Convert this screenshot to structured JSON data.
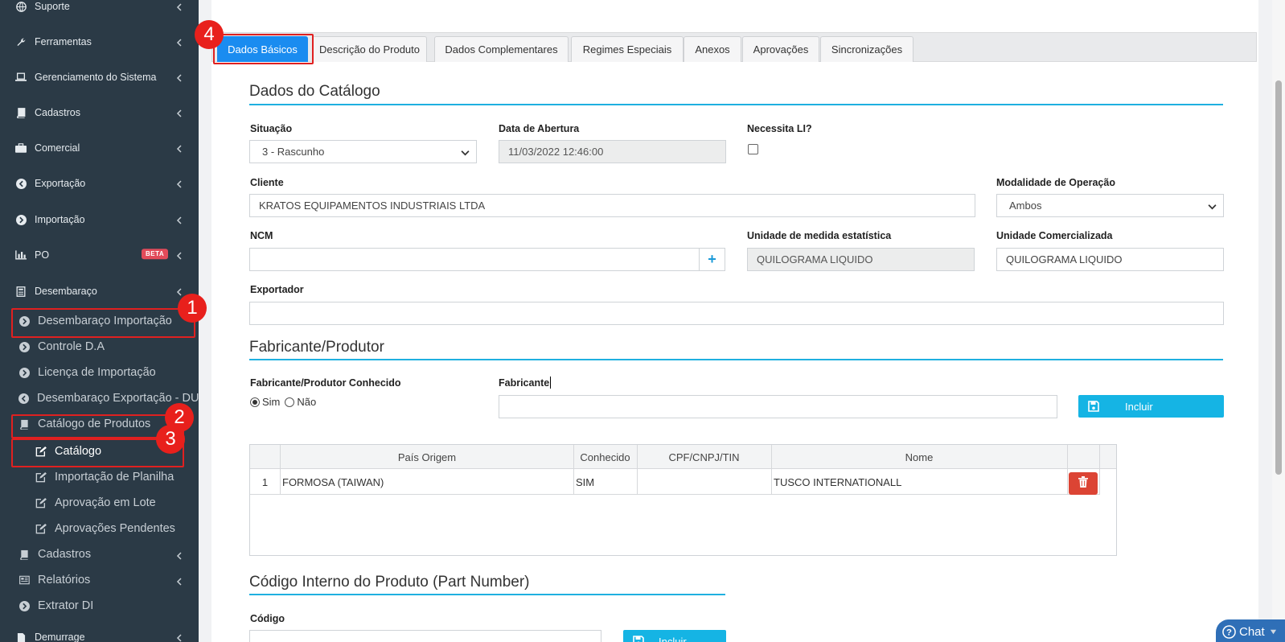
{
  "sidebar": {
    "items": [
      {
        "label": "Suporte",
        "icon": "globe-icon"
      },
      {
        "label": "Ferramentas",
        "icon": "wrench-icon"
      },
      {
        "label": "Gerenciamento do Sistema",
        "icon": "laptop-icon"
      },
      {
        "label": "Cadastros",
        "icon": "book-icon"
      },
      {
        "label": "Comercial",
        "icon": "briefcase-icon"
      },
      {
        "label": "Exportação",
        "icon": "arrow-circle-left-icon"
      },
      {
        "label": "Importação",
        "icon": "arrow-circle-right-icon"
      },
      {
        "label": "PO",
        "icon": "bar-chart-icon",
        "badge": "BETA"
      },
      {
        "label": "Desembaraço",
        "icon": "calculator-icon"
      }
    ],
    "subitems": [
      {
        "label": "Desembaraço Importação",
        "icon": "arrow-circle-right-icon"
      },
      {
        "label": "Controle D.A",
        "icon": "arrow-circle-right-icon"
      },
      {
        "label": "Licença de Importação",
        "icon": "arrow-circle-right-icon"
      },
      {
        "label": "Desembaraço Exportação - DUE",
        "icon": "arrow-circle-left-icon"
      },
      {
        "label": "Catálogo de Produtos",
        "icon": "book-icon"
      },
      {
        "label": "Catálogo",
        "icon": "edit-icon"
      },
      {
        "label": "Importação de Planilha",
        "icon": "edit-icon"
      },
      {
        "label": "Aprovação em Lote",
        "icon": "edit-icon"
      },
      {
        "label": "Aprovações Pendentes",
        "icon": "edit-icon"
      },
      {
        "label": "Cadastros",
        "icon": "book-icon"
      },
      {
        "label": "Relatórios",
        "icon": "newspaper-icon"
      },
      {
        "label": "Extrator DI",
        "icon": "arrow-circle-right-icon"
      }
    ],
    "bottom_item": {
      "label": "Demurrage",
      "icon": "file-icon"
    }
  },
  "annotations": [
    "1",
    "2",
    "3",
    "4"
  ],
  "tabs": [
    {
      "label": "Dados Básicos",
      "active": true
    },
    {
      "label": "Descrição do Produto"
    },
    {
      "label": "Dados Complementares"
    },
    {
      "label": "Regimes Especiais"
    },
    {
      "label": "Anexos"
    },
    {
      "label": "Aprovações"
    },
    {
      "label": "Sincronizações"
    }
  ],
  "catalog": {
    "title": "Dados do Catálogo",
    "situacao": {
      "label": "Situação",
      "value": "3 - Rascunho"
    },
    "data_abertura": {
      "label": "Data de Abertura",
      "value": "11/03/2022 12:46:00"
    },
    "necessita_li": {
      "label": "Necessita LI?"
    },
    "cliente": {
      "label": "Cliente",
      "value": "KRATOS EQUIPAMENTOS INDUSTRIAIS LTDA"
    },
    "modalidade": {
      "label": "Modalidade de Operação",
      "value": "Ambos"
    },
    "ncm": {
      "label": "NCM",
      "value": "",
      "plus": "+"
    },
    "unidade_estatistica": {
      "label": "Unidade de medida estatística",
      "value": "QUILOGRAMA LIQUIDO"
    },
    "unidade_comercializada": {
      "label": "Unidade Comercializada",
      "value": "QUILOGRAMA LIQUIDO"
    },
    "exportador": {
      "label": "Exportador",
      "value": ""
    }
  },
  "fabricante": {
    "title": "Fabricante/Produtor",
    "conhecido_label": "Fabricante/Produtor Conhecido",
    "sim": "Sim",
    "nao": "Não",
    "fabricante_label": "Fabricante",
    "incluir": "Incluir",
    "table": {
      "headers": [
        "País Origem",
        "Conhecido",
        "CPF/CNPJ/TIN",
        "Nome"
      ],
      "rows": [
        {
          "num": "1",
          "pais": "FORMOSA (TAIWAN)",
          "conhecido": "SIM",
          "doc": "",
          "nome": "TUSCO INTERNATIONALL"
        }
      ]
    }
  },
  "codigo": {
    "title": "Código Interno do Produto (Part Number)",
    "label": "Código",
    "incluir": "Incluir"
  },
  "chat": {
    "label": "Chat"
  }
}
